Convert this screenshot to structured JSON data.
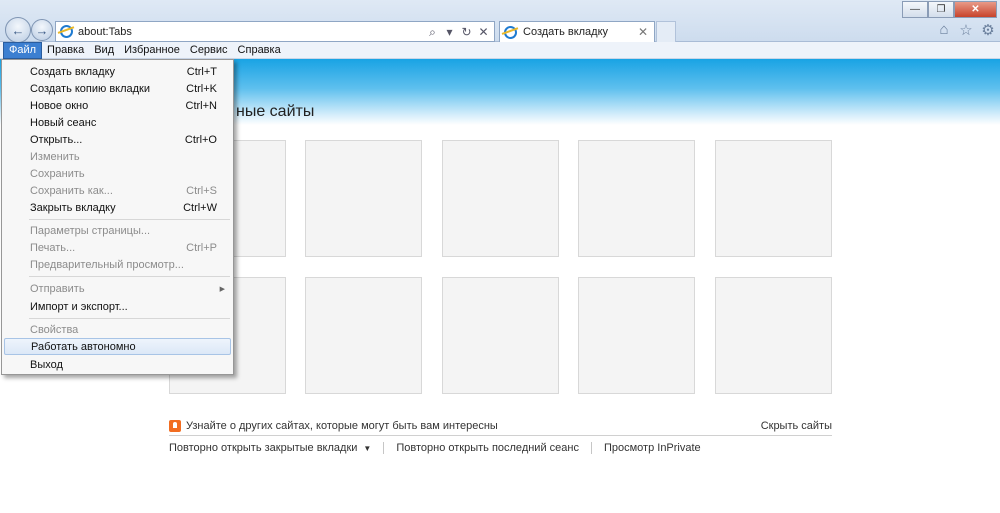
{
  "window": {
    "controls": {
      "minimize": "—",
      "maximize": "❐",
      "close": "✕"
    }
  },
  "address": {
    "url": "about:Tabs",
    "search_icon": "⌕",
    "dropdown_icon": "▾",
    "refresh_icon": "↻",
    "stop_icon": "✕"
  },
  "tab": {
    "title": "Создать вкладку",
    "close": "✕"
  },
  "toolbar_icons": {
    "home": "⌂",
    "favorites": "☆",
    "tools": "⚙"
  },
  "menubar": {
    "items": [
      "Файл",
      "Правка",
      "Вид",
      "Избранное",
      "Сервис",
      "Справка"
    ]
  },
  "file_menu": {
    "items": [
      {
        "label": "Создать вкладку",
        "shortcut": "Ctrl+T",
        "enabled": true
      },
      {
        "label": "Создать копию вкладки",
        "shortcut": "Ctrl+K",
        "enabled": true
      },
      {
        "label": "Новое окно",
        "shortcut": "Ctrl+N",
        "enabled": true
      },
      {
        "label": "Новый сеанс",
        "shortcut": "",
        "enabled": true
      },
      {
        "label": "Открыть...",
        "shortcut": "Ctrl+O",
        "enabled": true
      },
      {
        "label": "Изменить",
        "shortcut": "",
        "enabled": false
      },
      {
        "label": "Сохранить",
        "shortcut": "",
        "enabled": false
      },
      {
        "label": "Сохранить как...",
        "shortcut": "Ctrl+S",
        "enabled": false
      },
      {
        "label": "Закрыть вкладку",
        "shortcut": "Ctrl+W",
        "enabled": true
      },
      {
        "label": "Параметры страницы...",
        "shortcut": "",
        "enabled": false
      },
      {
        "label": "Печать...",
        "shortcut": "Ctrl+P",
        "enabled": false
      },
      {
        "label": "Предварительный просмотр...",
        "shortcut": "",
        "enabled": false
      },
      {
        "label": "Отправить",
        "shortcut": "",
        "enabled": false
      },
      {
        "label": "Импорт и экспорт...",
        "shortcut": "",
        "enabled": true
      },
      {
        "label": "Свойства",
        "shortcut": "",
        "enabled": false
      },
      {
        "label": "Работать автономно",
        "shortcut": "",
        "enabled": true
      },
      {
        "label": "Выход",
        "shortcut": "",
        "enabled": true
      }
    ]
  },
  "page": {
    "heading": "ные сайты",
    "discover_text": "Узнайте о других сайтах, которые могут быть вам интересны",
    "hide_sites": "Скрыть сайты",
    "links": {
      "reopen_tabs": "Повторно открыть закрытые вкладки",
      "reopen_session": "Повторно открыть последний сеанс",
      "inprivate": "Просмотр InPrivate"
    }
  },
  "colors": {
    "banner": "#19a3e4",
    "menu_active": "#3c7fd1",
    "discover_icon": "#f26d21"
  }
}
